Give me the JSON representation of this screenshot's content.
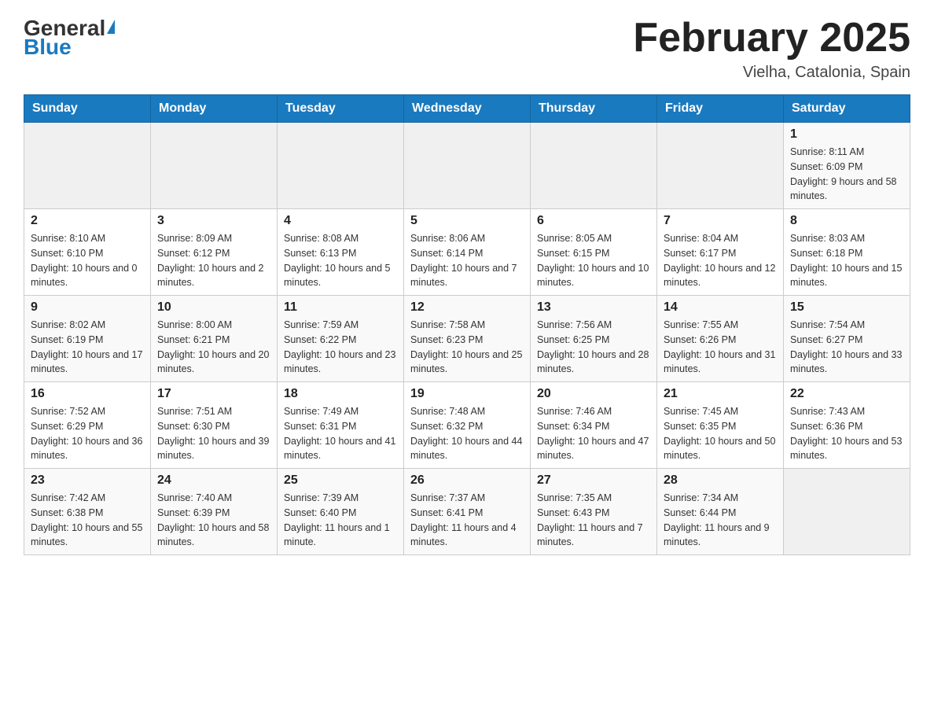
{
  "header": {
    "logo_general": "General",
    "logo_blue": "Blue",
    "title": "February 2025",
    "subtitle": "Vielha, Catalonia, Spain"
  },
  "days_of_week": [
    "Sunday",
    "Monday",
    "Tuesday",
    "Wednesday",
    "Thursday",
    "Friday",
    "Saturday"
  ],
  "weeks": [
    {
      "days": [
        {
          "num": "",
          "info": ""
        },
        {
          "num": "",
          "info": ""
        },
        {
          "num": "",
          "info": ""
        },
        {
          "num": "",
          "info": ""
        },
        {
          "num": "",
          "info": ""
        },
        {
          "num": "",
          "info": ""
        },
        {
          "num": "1",
          "info": "Sunrise: 8:11 AM\nSunset: 6:09 PM\nDaylight: 9 hours and 58 minutes."
        }
      ]
    },
    {
      "days": [
        {
          "num": "2",
          "info": "Sunrise: 8:10 AM\nSunset: 6:10 PM\nDaylight: 10 hours and 0 minutes."
        },
        {
          "num": "3",
          "info": "Sunrise: 8:09 AM\nSunset: 6:12 PM\nDaylight: 10 hours and 2 minutes."
        },
        {
          "num": "4",
          "info": "Sunrise: 8:08 AM\nSunset: 6:13 PM\nDaylight: 10 hours and 5 minutes."
        },
        {
          "num": "5",
          "info": "Sunrise: 8:06 AM\nSunset: 6:14 PM\nDaylight: 10 hours and 7 minutes."
        },
        {
          "num": "6",
          "info": "Sunrise: 8:05 AM\nSunset: 6:15 PM\nDaylight: 10 hours and 10 minutes."
        },
        {
          "num": "7",
          "info": "Sunrise: 8:04 AM\nSunset: 6:17 PM\nDaylight: 10 hours and 12 minutes."
        },
        {
          "num": "8",
          "info": "Sunrise: 8:03 AM\nSunset: 6:18 PM\nDaylight: 10 hours and 15 minutes."
        }
      ]
    },
    {
      "days": [
        {
          "num": "9",
          "info": "Sunrise: 8:02 AM\nSunset: 6:19 PM\nDaylight: 10 hours and 17 minutes."
        },
        {
          "num": "10",
          "info": "Sunrise: 8:00 AM\nSunset: 6:21 PM\nDaylight: 10 hours and 20 minutes."
        },
        {
          "num": "11",
          "info": "Sunrise: 7:59 AM\nSunset: 6:22 PM\nDaylight: 10 hours and 23 minutes."
        },
        {
          "num": "12",
          "info": "Sunrise: 7:58 AM\nSunset: 6:23 PM\nDaylight: 10 hours and 25 minutes."
        },
        {
          "num": "13",
          "info": "Sunrise: 7:56 AM\nSunset: 6:25 PM\nDaylight: 10 hours and 28 minutes."
        },
        {
          "num": "14",
          "info": "Sunrise: 7:55 AM\nSunset: 6:26 PM\nDaylight: 10 hours and 31 minutes."
        },
        {
          "num": "15",
          "info": "Sunrise: 7:54 AM\nSunset: 6:27 PM\nDaylight: 10 hours and 33 minutes."
        }
      ]
    },
    {
      "days": [
        {
          "num": "16",
          "info": "Sunrise: 7:52 AM\nSunset: 6:29 PM\nDaylight: 10 hours and 36 minutes."
        },
        {
          "num": "17",
          "info": "Sunrise: 7:51 AM\nSunset: 6:30 PM\nDaylight: 10 hours and 39 minutes."
        },
        {
          "num": "18",
          "info": "Sunrise: 7:49 AM\nSunset: 6:31 PM\nDaylight: 10 hours and 41 minutes."
        },
        {
          "num": "19",
          "info": "Sunrise: 7:48 AM\nSunset: 6:32 PM\nDaylight: 10 hours and 44 minutes."
        },
        {
          "num": "20",
          "info": "Sunrise: 7:46 AM\nSunset: 6:34 PM\nDaylight: 10 hours and 47 minutes."
        },
        {
          "num": "21",
          "info": "Sunrise: 7:45 AM\nSunset: 6:35 PM\nDaylight: 10 hours and 50 minutes."
        },
        {
          "num": "22",
          "info": "Sunrise: 7:43 AM\nSunset: 6:36 PM\nDaylight: 10 hours and 53 minutes."
        }
      ]
    },
    {
      "days": [
        {
          "num": "23",
          "info": "Sunrise: 7:42 AM\nSunset: 6:38 PM\nDaylight: 10 hours and 55 minutes."
        },
        {
          "num": "24",
          "info": "Sunrise: 7:40 AM\nSunset: 6:39 PM\nDaylight: 10 hours and 58 minutes."
        },
        {
          "num": "25",
          "info": "Sunrise: 7:39 AM\nSunset: 6:40 PM\nDaylight: 11 hours and 1 minute."
        },
        {
          "num": "26",
          "info": "Sunrise: 7:37 AM\nSunset: 6:41 PM\nDaylight: 11 hours and 4 minutes."
        },
        {
          "num": "27",
          "info": "Sunrise: 7:35 AM\nSunset: 6:43 PM\nDaylight: 11 hours and 7 minutes."
        },
        {
          "num": "28",
          "info": "Sunrise: 7:34 AM\nSunset: 6:44 PM\nDaylight: 11 hours and 9 minutes."
        },
        {
          "num": "",
          "info": ""
        }
      ]
    }
  ]
}
